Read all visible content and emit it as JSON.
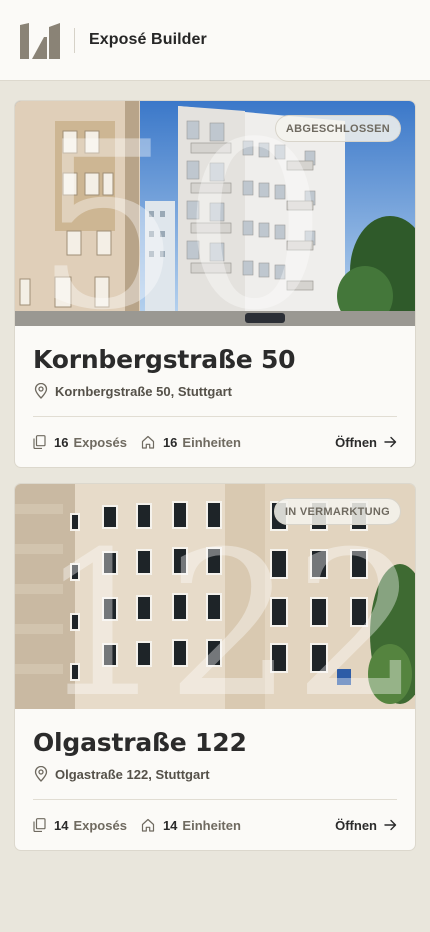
{
  "app": {
    "title": "Exposé Builder"
  },
  "projects": [
    {
      "title": "Kornbergstraße 50",
      "address": "Kornbergstraße 50, Stuttgart",
      "status": "ABGESCHLOSSEN",
      "watermark": "50",
      "stats": {
        "exposes_count": "16",
        "exposes_label": "Exposés",
        "units_count": "16",
        "units_label": "Einheiten"
      },
      "open_label": "Öffnen"
    },
    {
      "title": "Olgastraße 122",
      "address": "Olgastraße 122, Stuttgart",
      "status": "IN VERMARKTUNG",
      "watermark": "122",
      "stats": {
        "exposes_count": "14",
        "exposes_label": "Exposés",
        "units_count": "14",
        "units_label": "Einheiten"
      },
      "open_label": "Öffnen"
    }
  ],
  "colors": {
    "background": "#e9e6dc",
    "card": "#fbfaf7",
    "text": "#2b2b2b",
    "muted": "#6f6a60",
    "logo": "#8a8376"
  },
  "icons": {
    "logo": "brand-logo",
    "pin": "map-pin-icon",
    "exposes": "documents-icon",
    "units": "house-icon",
    "open": "arrow-right-icon"
  }
}
